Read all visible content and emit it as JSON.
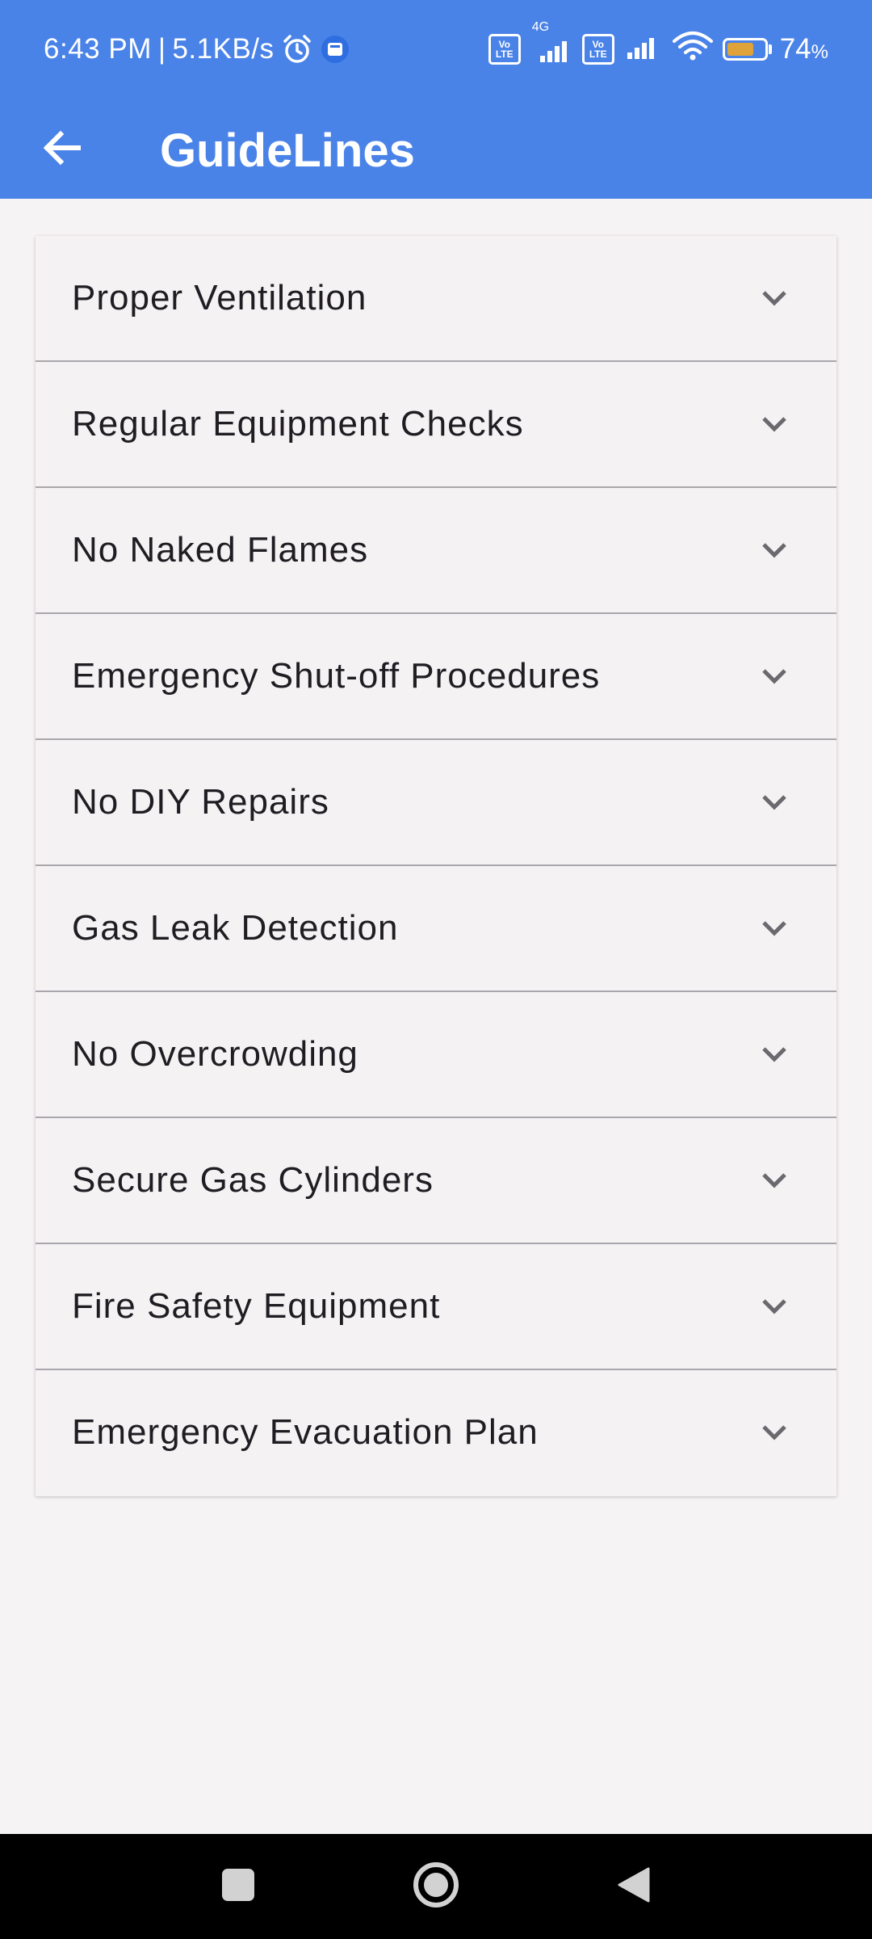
{
  "status_bar": {
    "time": "6:43 PM",
    "separator": "|",
    "network_speed": "5.1KB/s",
    "battery_percent": "74",
    "battery_unit": "%",
    "network_type": "4G",
    "volte_label_top": "Vo",
    "volte_label_bottom": "LTE",
    "battery_level": 0.74,
    "icons": [
      "alarm-icon",
      "app-notification-icon",
      "volte-icon",
      "signal-icon",
      "wifi-icon",
      "battery-icon"
    ]
  },
  "app_bar": {
    "title": "GuideLines",
    "back_icon": "back-arrow-icon",
    "color": "#4a83e8"
  },
  "guidelines": {
    "items": [
      {
        "label": "Proper Ventilation"
      },
      {
        "label": "Regular Equipment Checks"
      },
      {
        "label": "No Naked Flames"
      },
      {
        "label": "Emergency Shut-off Procedures"
      },
      {
        "label": "No DIY Repairs"
      },
      {
        "label": "Gas Leak Detection"
      },
      {
        "label": "No Overcrowding"
      },
      {
        "label": "Secure Gas Cylinders"
      },
      {
        "label": "Fire Safety Equipment"
      },
      {
        "label": "Emergency Evacuation Plan"
      }
    ],
    "expand_icon": "chevron-down-icon"
  },
  "nav_bar": {
    "buttons": [
      "recents-square-icon",
      "home-circle-icon",
      "back-triangle-icon"
    ]
  }
}
